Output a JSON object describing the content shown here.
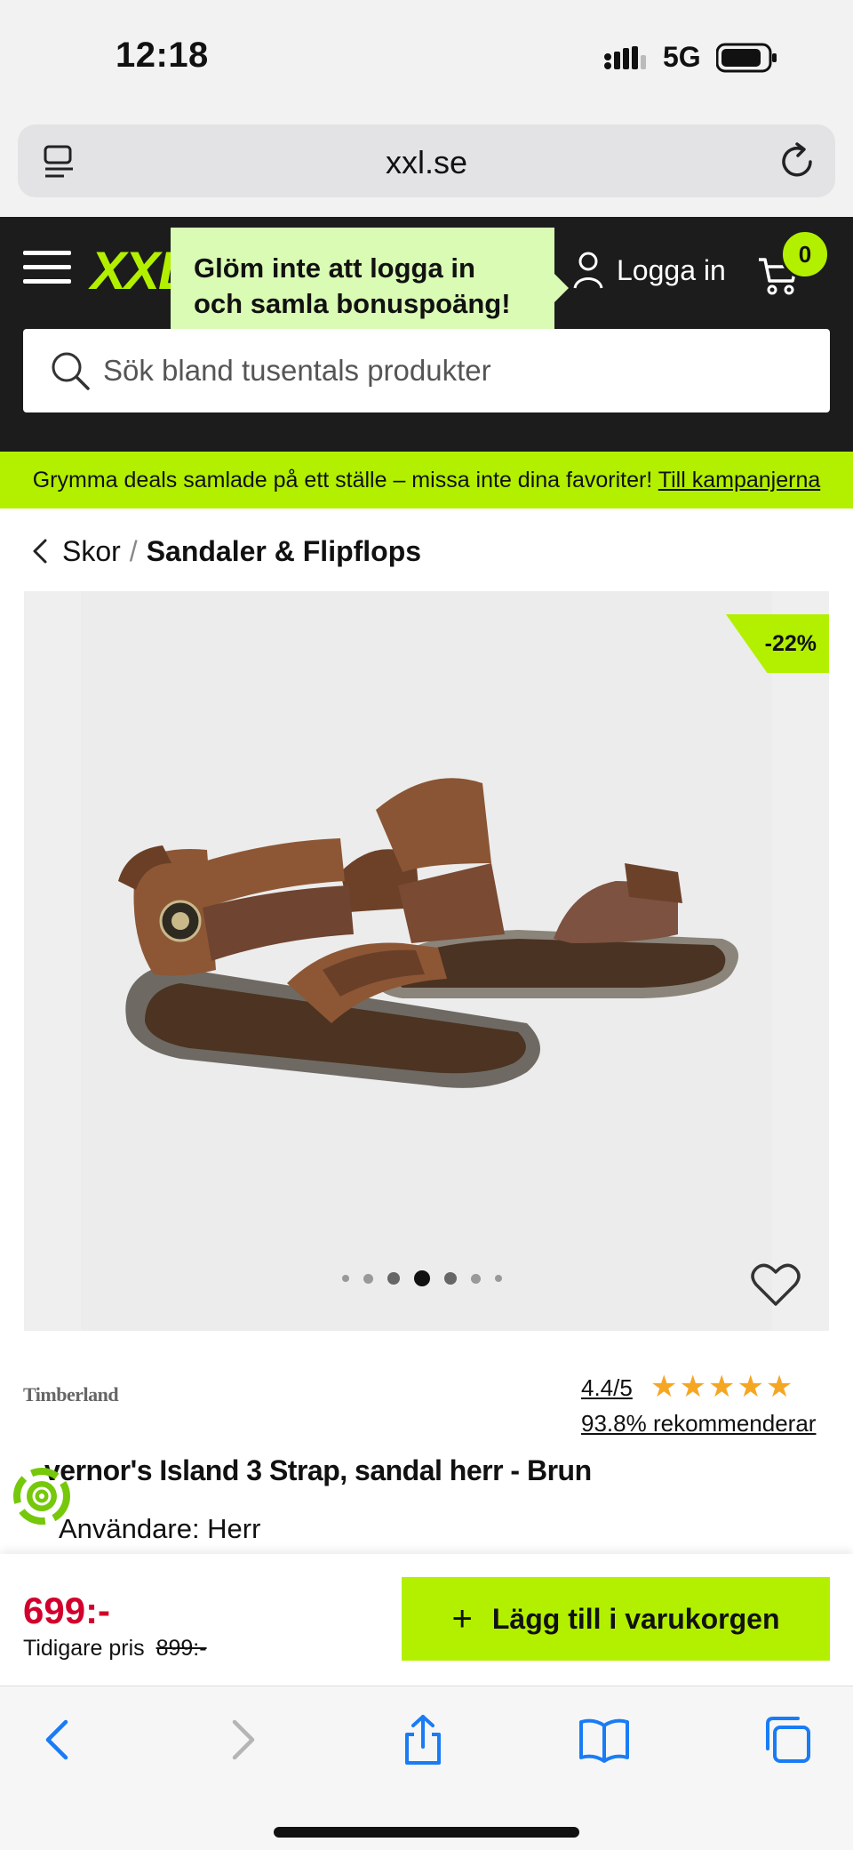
{
  "status_bar": {
    "time": "12:18",
    "network": "5G"
  },
  "browser": {
    "url": "xxl.se"
  },
  "header": {
    "logo": "XXL",
    "tooltip": "Glöm inte att logga in och samla bonuspoäng!",
    "login_label": "Logga in",
    "cart_count": "0",
    "search_placeholder": "Sök bland tusentals produkter"
  },
  "promo": {
    "text": "Grymma deals samlade på ett ställe – missa inte dina favoriter!",
    "link": "Till kampanjerna"
  },
  "breadcrumb": {
    "parent": "Skor",
    "separator": "/",
    "current": "Sandaler & Flipflops"
  },
  "product": {
    "discount": "-22%",
    "image_count": 7,
    "active_image": 4,
    "brand": "Timberland",
    "rating": "4.4/5",
    "rating_value": 4.4,
    "stars": "★★★★★",
    "recommend": "93.8% rekommenderar",
    "title": "vernor's Island 3 Strap, sandal herr - Brun",
    "user": "Användare: Herr"
  },
  "price": {
    "current": "699:-",
    "previous_label": "Tidigare pris",
    "previous_value": "899:-"
  },
  "cart_button": {
    "label": "Lägg till i varukorgen"
  },
  "colors": {
    "accent": "#b2f000",
    "header_bg": "#1c1c1c",
    "price": "#d2002c",
    "tooltip_bg": "#d9fbb4",
    "ios_blue": "#1a7cf5"
  }
}
